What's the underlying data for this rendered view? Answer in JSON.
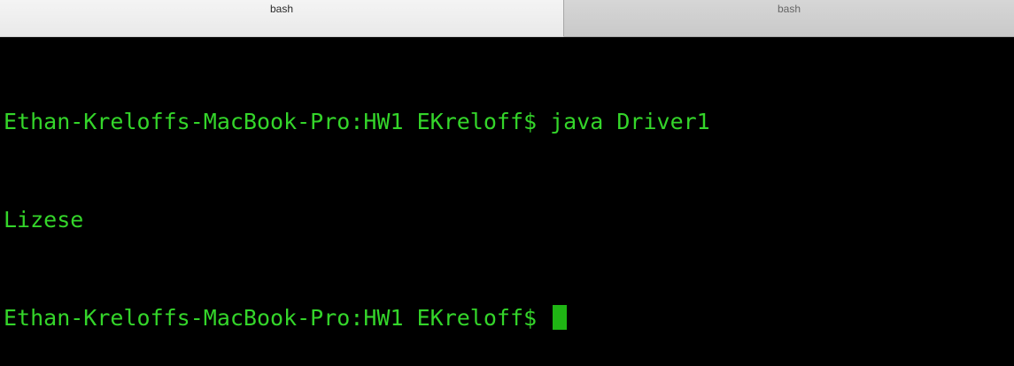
{
  "tabs": [
    {
      "label": "bash",
      "active": true
    },
    {
      "label": "bash",
      "active": false
    }
  ],
  "terminal": {
    "lines": [
      "Ethan-Kreloffs-MacBook-Pro:HW1 EKreloff$ java Driver1",
      "Lizese",
      "Ethan-Kreloffs-MacBook-Pro:HW1 EKreloff$ "
    ],
    "cursor_icon": "block-cursor-icon"
  },
  "colors": {
    "text": "#34d52a",
    "cursor": "#1fb514",
    "background": "#000000",
    "active_tab": "#ececec",
    "inactive_tab": "#cfcfcf"
  }
}
